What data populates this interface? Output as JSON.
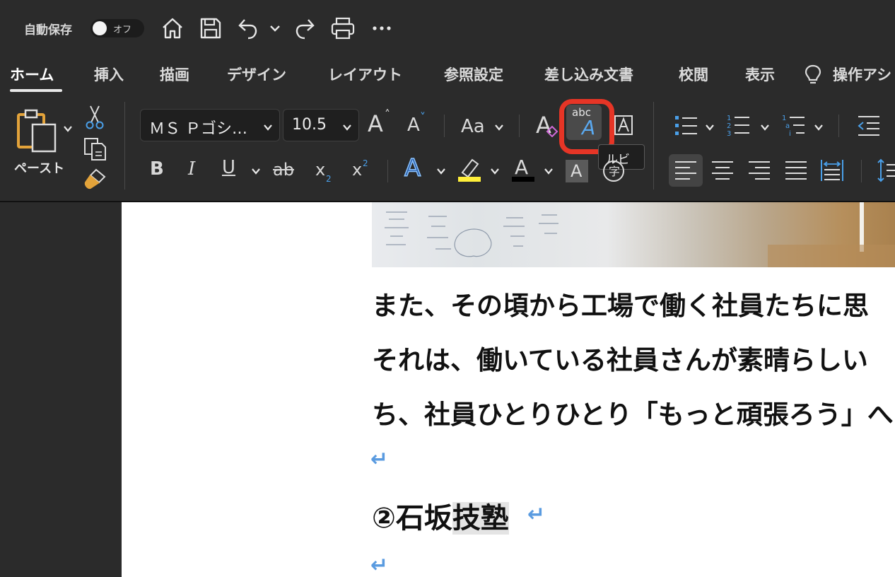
{
  "titlebar": {
    "autosave_label": "自動保存",
    "toggle_state": "オフ",
    "icons": [
      "home-icon",
      "save-icon",
      "undo-icon",
      "undo-dropdown-icon",
      "redo-icon",
      "print-icon",
      "more-icon"
    ]
  },
  "tabs": [
    "ホーム",
    "挿入",
    "描画",
    "デザイン",
    "レイアウト",
    "参照設定",
    "差し込み文書",
    "校閲",
    "表示",
    "操作アシ"
  ],
  "ribbon": {
    "paste_label": "ペースト",
    "font_name": "ＭＳ Ｐゴシ…",
    "font_size": "10.5",
    "change_case": "Aa",
    "ruby_small": "abc",
    "ruby_big": "A",
    "tooltip": "ルビ",
    "bold": "B",
    "italic": "I",
    "underline": "U",
    "strike": "ab",
    "subscript": "x",
    "superscript": "x",
    "grow": "A",
    "shrink": "A",
    "clear": "A",
    "effects": "A",
    "font_color": "A",
    "shading": "A",
    "enclose": "字",
    "border": "A",
    "colors": {
      "accent_ring": "#e63526",
      "highlight": "#ffef3a",
      "font_color_bar": "#000000"
    }
  },
  "document": {
    "lines": [
      "また、その頃から工場で働く社員たちに思",
      "それは、働いている社員さんが素晴らしい",
      "ち、社員ひとりひとり「もっと頑張ろう」へと"
    ],
    "paragraph_mark": "↵",
    "heading_prefix": "②石坂",
    "heading_selected": "技塾"
  }
}
